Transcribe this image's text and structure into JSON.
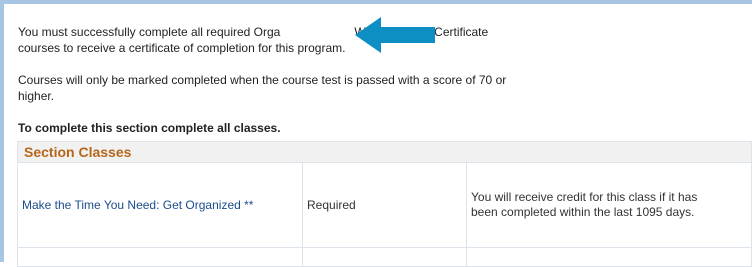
{
  "intro": {
    "line1_part1": "You must successfully complete all required Orga",
    "line1_part2": "Worker Online Certificate",
    "line2": "courses to receive a certificate of completion for this program.",
    "line3": "Courses will only be marked completed when the course test is passed with a score of 70 or",
    "line4": "higher."
  },
  "section_instruction": "To complete this section complete all classes.",
  "section_classes": {
    "header": "Section Classes",
    "rows": [
      {
        "course": "Make the Time You Need: Get Organized **",
        "requirement": "Required",
        "credit": "You will receive credit for this class if it has been completed within the last 1095 days."
      }
    ]
  },
  "colors": {
    "frame": "#a9c5e4",
    "header_text": "#b5661b",
    "link": "#1a4e8a",
    "arrow": "#0e8fc4"
  },
  "icons": {
    "annotation_arrow": "left-arrow-icon"
  }
}
